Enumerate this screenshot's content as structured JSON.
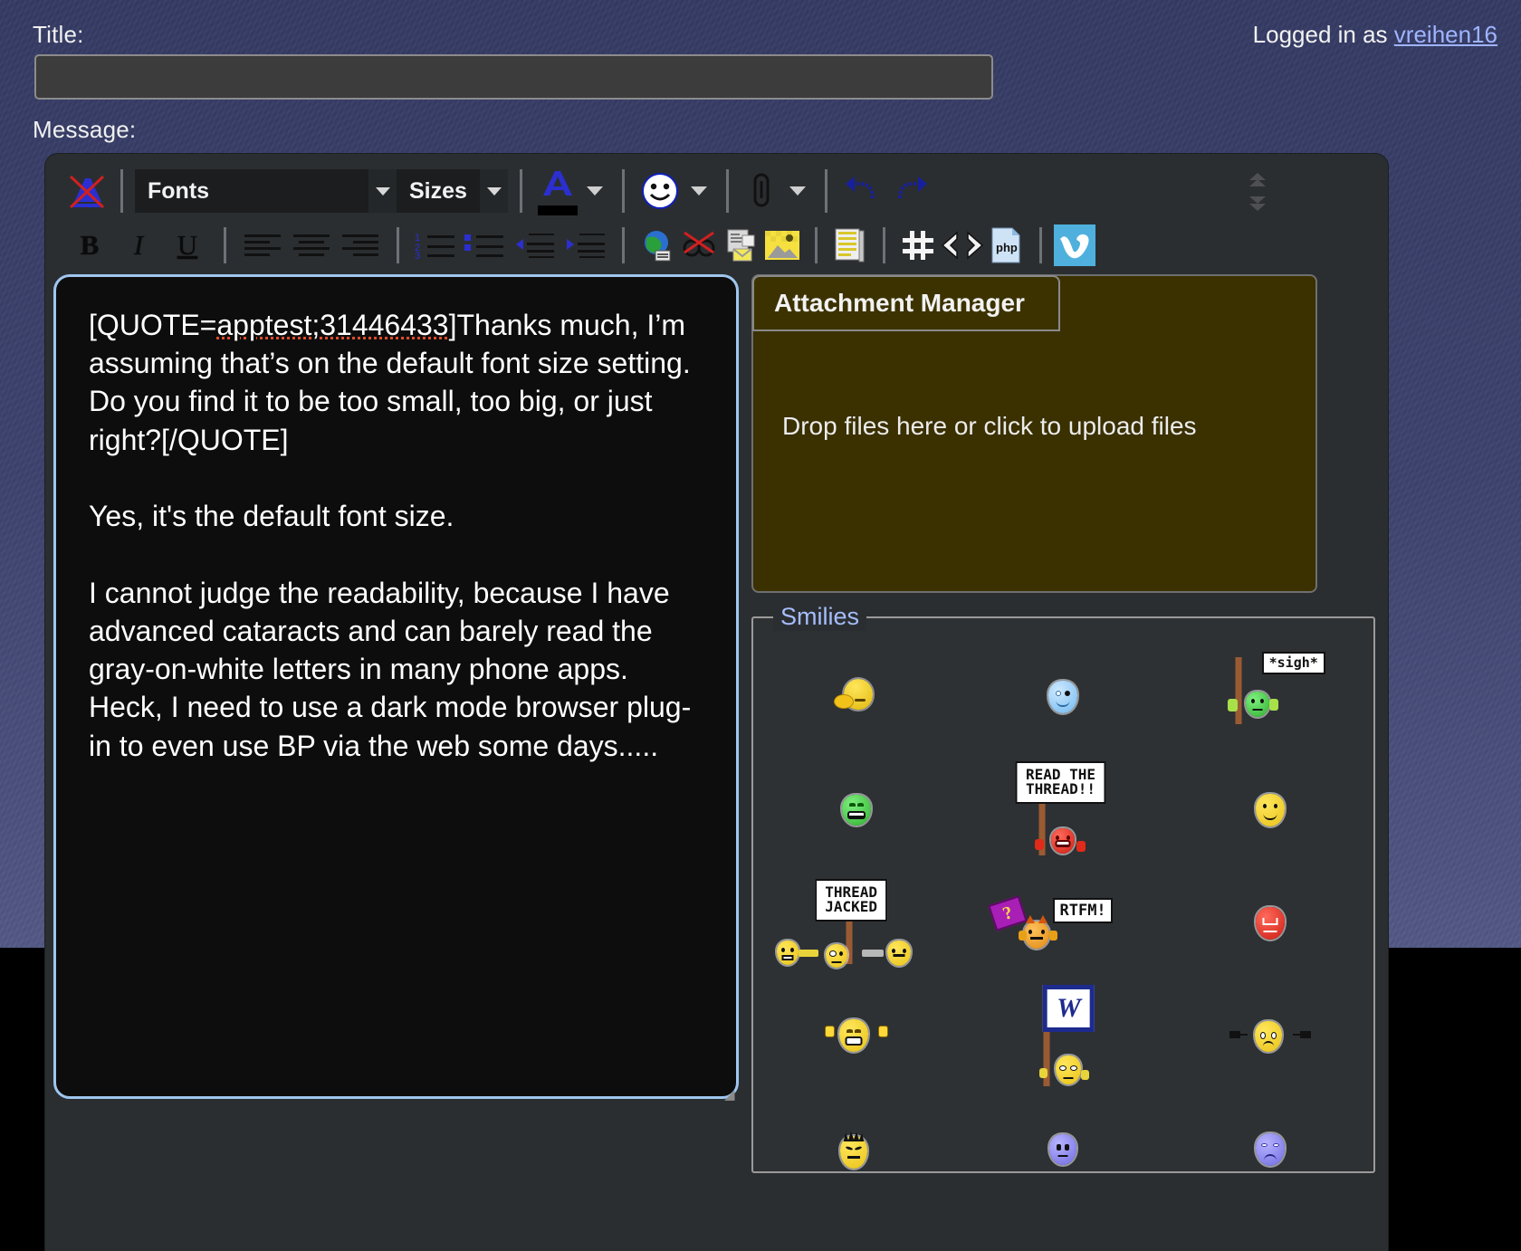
{
  "header": {
    "title_label": "Title:",
    "title_value": "",
    "title_placeholder": "",
    "message_label": "Message:",
    "login_prefix": "Logged in as ",
    "login_user": "vreihen16"
  },
  "toolbar": {
    "row1": [
      {
        "name": "remove-formatting-icon",
        "label": "Remove Formatting",
        "type": "icon"
      },
      {
        "name": "font-family-select",
        "label": "Fonts",
        "type": "combo"
      },
      {
        "name": "font-size-select",
        "label": "Sizes",
        "type": "combo"
      },
      {
        "name": "font-color-button",
        "label": "Font Color",
        "type": "color",
        "color": "#000000"
      },
      {
        "name": "smilies-button",
        "label": "Insert Smilie",
        "type": "icon"
      },
      {
        "name": "attach-button",
        "label": "Attach Files",
        "type": "icon"
      },
      {
        "name": "undo-button",
        "label": "Undo",
        "type": "icon"
      },
      {
        "name": "redo-button",
        "label": "Redo",
        "type": "icon"
      }
    ],
    "row2": [
      {
        "name": "bold-button",
        "label": "B"
      },
      {
        "name": "italic-button",
        "label": "I"
      },
      {
        "name": "underline-button",
        "label": "U"
      },
      {
        "name": "align-left-button",
        "label": "Align Left"
      },
      {
        "name": "align-center-button",
        "label": "Align Center"
      },
      {
        "name": "align-right-button",
        "label": "Align Right"
      },
      {
        "name": "ordered-list-button",
        "label": "Numbered List"
      },
      {
        "name": "unordered-list-button",
        "label": "Bulleted List"
      },
      {
        "name": "outdent-button",
        "label": "Decrease Indent"
      },
      {
        "name": "indent-button",
        "label": "Increase Indent"
      },
      {
        "name": "insert-link-button",
        "label": "Insert Link"
      },
      {
        "name": "unlink-button",
        "label": "Remove Link"
      },
      {
        "name": "insert-email-button",
        "label": "Insert Email"
      },
      {
        "name": "insert-image-button",
        "label": "Insert Image"
      },
      {
        "name": "insert-quote-button",
        "label": "Insert Quote"
      },
      {
        "name": "insert-code-button",
        "label": "Code"
      },
      {
        "name": "insert-html-button",
        "label": "HTML"
      },
      {
        "name": "insert-php-button",
        "label": "PHP"
      },
      {
        "name": "insert-vimeo-button",
        "label": "Vimeo",
        "active": true
      }
    ],
    "scroll_up_label": "Scroll toolbar up",
    "scroll_down_label": "Scroll toolbar down"
  },
  "message": {
    "quote_prefix": "[QUOTE=",
    "quote_misspelled": "apptest;31446433",
    "quote_after": "]Thanks much, I’m assuming that’s on the default font size setting.  Do you find it to be too small, too big, or just right?[/QUOTE]",
    "body_line_1": "Yes, it's the default font size.",
    "body_line_2": "I cannot judge the readability, because I have advanced cataracts and can barely read the gray-on-white letters in many phone apps.  Heck, I need to use a dark mode browser plug-in to even use BP via the web some days....."
  },
  "attachment": {
    "header": "Attachment Manager",
    "drop_text": "Drop files here or click to upload files"
  },
  "smilies": {
    "legend": "Smilies",
    "items": [
      {
        "name": "smiley-facepalm",
        "title": ":facepalm:"
      },
      {
        "name": "smiley-cool-blue",
        "title": ":cool:"
      },
      {
        "name": "smiley-sigh-sign",
        "title": "*sigh*",
        "sign_text": "*sigh*"
      },
      {
        "name": "smiley-green-grin",
        "title": ":D"
      },
      {
        "name": "smiley-read-the-thread",
        "title": "Read the thread!!",
        "sign_text": "READ THE\nTHREAD!!"
      },
      {
        "name": "smiley-smile",
        "title": ":)"
      },
      {
        "name": "smiley-thread-jacked",
        "title": "Thread jacked",
        "sign_text": "THREAD\nJACKED"
      },
      {
        "name": "smiley-rtfm",
        "title": "RTFM!",
        "sign_text": "RTFM!"
      },
      {
        "name": "smiley-no-entry",
        "title": ":nono:"
      },
      {
        "name": "smiley-applause",
        "title": ":clap:"
      },
      {
        "name": "smiley-word-sign",
        "title": "Word!",
        "sign_text": "W"
      },
      {
        "name": "smiley-unplugged",
        "title": ":unplug:"
      },
      {
        "name": "smiley-mad-hair",
        "title": ":mad:"
      },
      {
        "name": "smiley-neutral-blue",
        "title": ":|"
      },
      {
        "name": "smiley-sad-purple",
        "title": ":("
      }
    ]
  },
  "colors": {
    "page_bg": "#3c426d",
    "editor_bg": "#2b2e31",
    "textarea_bg": "#0d0d0d",
    "textarea_border": "#9fc6ef",
    "attachment_bg": "#3a3000",
    "link": "#9fb4ff",
    "legend": "#a5bdfb",
    "accent_active": "#4fb0dd",
    "spellcheck": "#e04b2a"
  }
}
